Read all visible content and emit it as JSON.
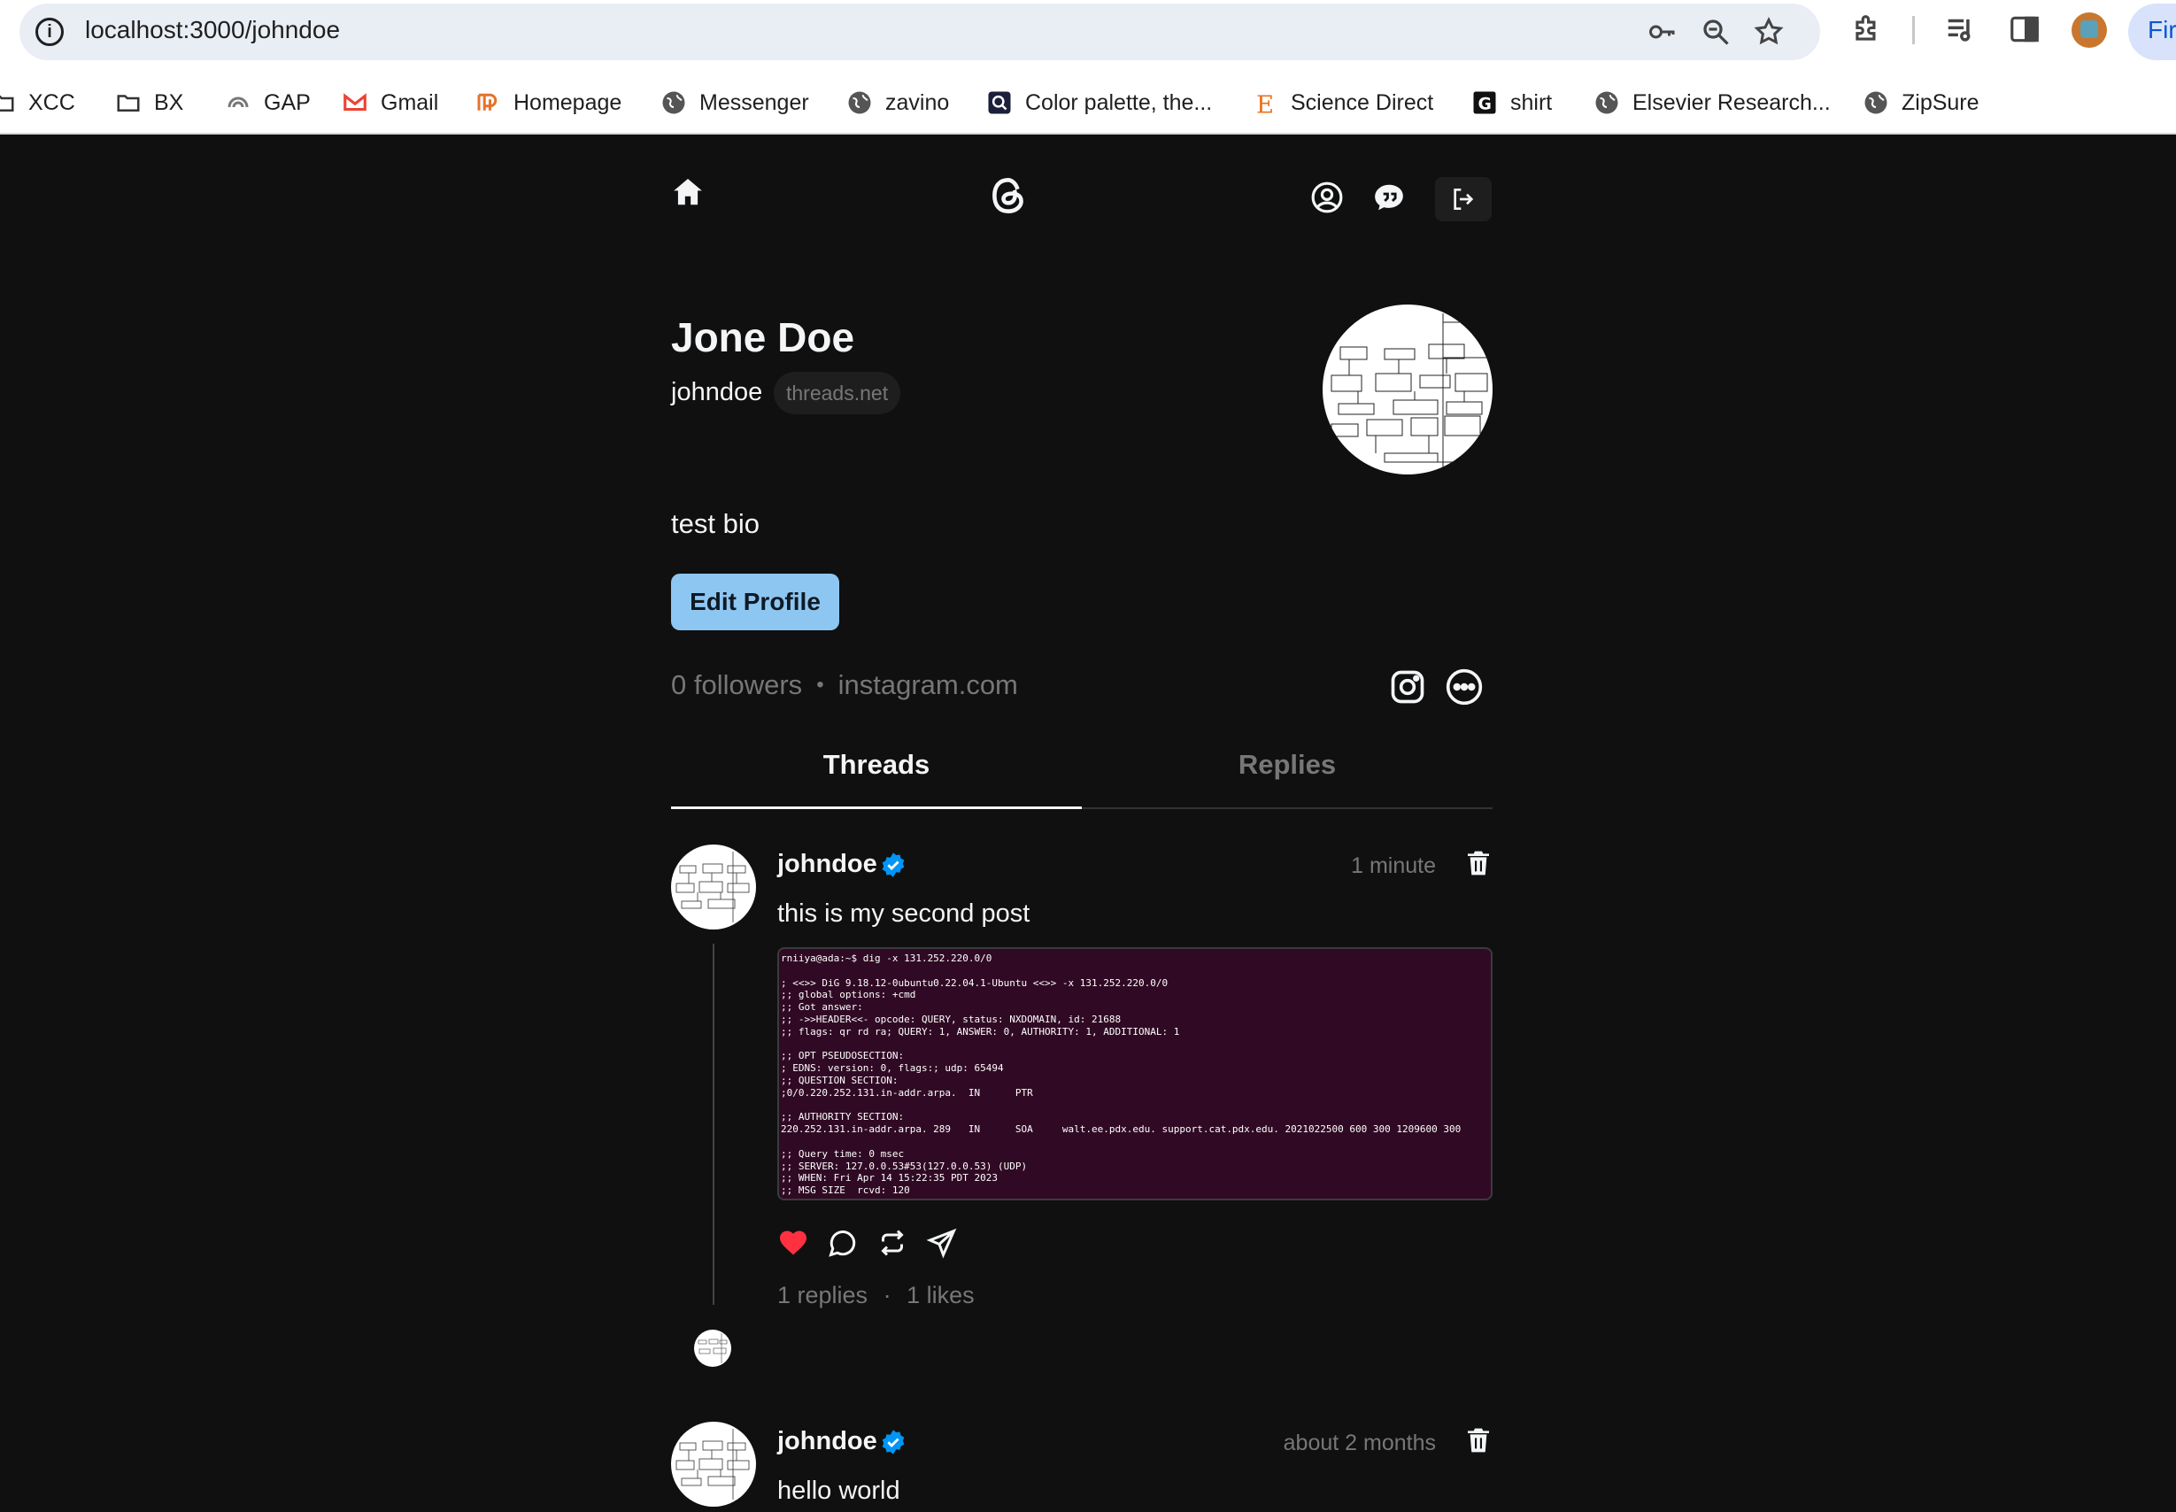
{
  "browser": {
    "url": "localhost:3000/johndoe",
    "edge_button_label": "Fir",
    "bookmarks": [
      "XCC",
      "BX",
      "GAP",
      "Gmail",
      "Homepage",
      "Messenger",
      "zavino",
      "Color palette, the...",
      "Science Direct",
      "shirt",
      "Elsevier Research...",
      "ZipSure"
    ]
  },
  "nav": {
    "home_icon": "home-icon",
    "logo_icon": "threads-logo-icon",
    "profile_icon": "user-circle-icon",
    "chat_icon": "chat-bubble-icon",
    "logout_icon": "logout-icon"
  },
  "profile": {
    "name": "Jone Doe",
    "username": "johndoe",
    "domain": "threads.net",
    "bio": "test bio",
    "edit_label": "Edit Profile",
    "followers": "0 followers",
    "separator": "•",
    "link": "instagram.com"
  },
  "tabs": [
    {
      "label": "Threads",
      "active": true
    },
    {
      "label": "Replies",
      "active": false
    }
  ],
  "posts": [
    {
      "username": "johndoe",
      "time": "1 minute",
      "text": "this is my second post",
      "liked": true,
      "replies": "1 replies",
      "sep": "·",
      "likes": "1 likes",
      "terminal": "rniiya@ada:~$ dig -x 131.252.220.0/0\n\n; <<>> DiG 9.18.12-0ubuntu0.22.04.1-Ubuntu <<>> -x 131.252.220.0/0\n;; global options: +cmd\n;; Got answer:\n;; ->>HEADER<<- opcode: QUERY, status: NXDOMAIN, id: 21688\n;; flags: qr rd ra; QUERY: 1, ANSWER: 0, AUTHORITY: 1, ADDITIONAL: 1\n\n;; OPT PSEUDOSECTION:\n; EDNS: version: 0, flags:; udp: 65494\n;; QUESTION SECTION:\n;0/0.220.252.131.in-addr.arpa.  IN      PTR\n\n;; AUTHORITY SECTION:\n220.252.131.in-addr.arpa. 289   IN      SOA     walt.ee.pdx.edu. support.cat.pdx.edu. 2021022500 600 300 1209600 300\n\n;; Query time: 0 msec\n;; SERVER: 127.0.0.53#53(127.0.0.53) (UDP)\n;; WHEN: Fri Apr 14 15:22:35 PDT 2023\n;; MSG SIZE  rcvd: 120"
    },
    {
      "username": "johndoe",
      "time": "about 2 months",
      "text": "hello world"
    }
  ],
  "colors": {
    "page_bg": "#101010",
    "text": "#f3f5f7",
    "muted": "#777777",
    "accent_button": "#8ec6f2",
    "verified": "#0095f6",
    "like": "#ff3040",
    "terminal_bg": "#300a24"
  }
}
